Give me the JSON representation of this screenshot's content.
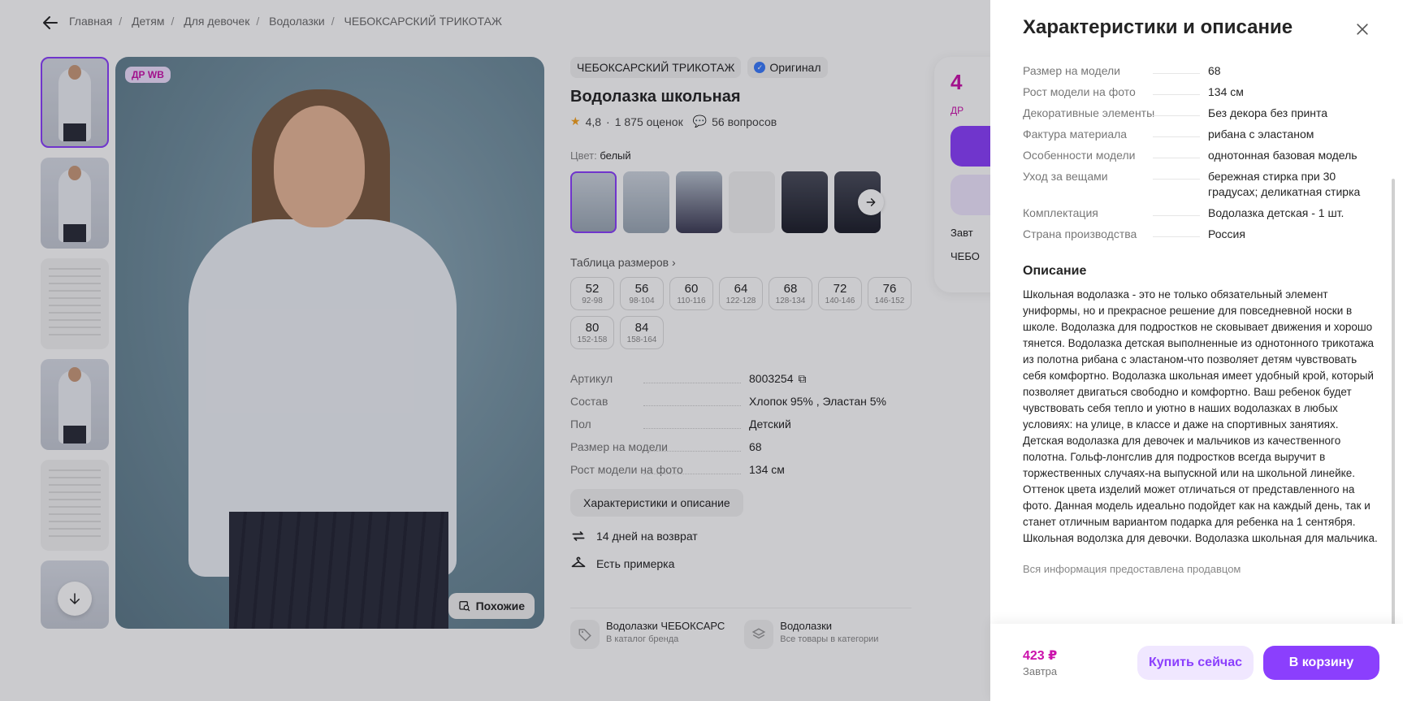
{
  "breadcrumb": [
    "Главная",
    "Детям",
    "Для девочек",
    "Водолазки",
    "ЧЕБОКСАРСКИЙ ТРИКОТАЖ"
  ],
  "gallery": {
    "badge": "ДР WB",
    "similar_label": "Похожие"
  },
  "product": {
    "brand": "ЧЕБОКСАРСКИЙ ТРИКОТАЖ",
    "original": "Оригинал",
    "title": "Водолазка школьная",
    "rating": "4,8",
    "reviews": "1 875 оценок",
    "questions": "56 вопросов",
    "color_label": "Цвет:",
    "color_value": "белый",
    "sizes_link": "Таблица размеров",
    "sizes": [
      {
        "n": "52",
        "r": "92-98"
      },
      {
        "n": "56",
        "r": "98-104"
      },
      {
        "n": "60",
        "r": "110-116"
      },
      {
        "n": "64",
        "r": "122-128"
      },
      {
        "n": "68",
        "r": "128-134"
      },
      {
        "n": "72",
        "r": "140-146"
      },
      {
        "n": "76",
        "r": "146-152"
      },
      {
        "n": "80",
        "r": "152-158"
      },
      {
        "n": "84",
        "r": "158-164"
      }
    ],
    "specs": [
      {
        "k": "Артикул",
        "v": "8003254"
      },
      {
        "k": "Состав",
        "v": "Хлопок 95% , Эластан 5%"
      },
      {
        "k": "Пол",
        "v": "Детский"
      },
      {
        "k": "Размер на модели",
        "v": "68"
      },
      {
        "k": "Рост модели на фото",
        "v": "134 см"
      }
    ],
    "specs_button": "Характеристики и описание",
    "perks": [
      "14 дней на возврат",
      "Есть примерка"
    ],
    "brand_link": {
      "title": "Водолазки ЧЕБОКСАРС",
      "sub": "В каталог бренда"
    },
    "category_link": {
      "title": "Водолазки",
      "sub": "Все товары в категории"
    }
  },
  "buybox": {
    "price_partial": "4",
    "dr_partial": "ДР",
    "delivery": "Завт",
    "seller": "ЧЕБО"
  },
  "drawer": {
    "title": "Характеристики и описание",
    "attributes": [
      {
        "k": "Размер на модели",
        "v": "68"
      },
      {
        "k": "Рост модели на фото",
        "v": "134 см"
      },
      {
        "k": "Декоративные элементы",
        "v": "Без декора без принта"
      },
      {
        "k": "Фактура материала",
        "v": "рибана с эластаном"
      },
      {
        "k": "Особенности модели",
        "v": "однотонная базовая модель"
      },
      {
        "k": "Уход за вещами",
        "v": "бережная стирка при 30 градусах; деликатная стирка"
      },
      {
        "k": "Комплектация",
        "v": "Водолазка детская - 1 шт."
      },
      {
        "k": "Страна производства",
        "v": "Россия"
      }
    ],
    "description_title": "Описание",
    "description": "Школьная водолазка - это не только обязательный элемент униформы, но и прекрасное решение для повседневной носки в школе. Водолазка для подростков не сковывает движения и хорошо тянется. Водолазка детская выполненные из однотонного трикотажа из полотна рибана с эластаном-что позволяет детям чувствовать себя комфортно. Водолазка школьная имеет удобный крой, который позволяет двигаться свободно и комфортно. Ваш ребенок будет чувствовать себя тепло и уютно в наших водолазках в любых условиях: на улице, в классе и даже на спортивных занятиях. Детская водолазка для девочек и мальчиков из качественного полотна. Гольф-лонгслив для подростков всегда выручит в торжественных случаях-на выпускной или на школьной линейке. Оттенок цвета изделий может отличаться от представленного на фото. Данная модель идеально подойдет как на каждый день, так и станет отличным вариантом подарка для ребенка на 1 сентября. Школьная водолзка для девочки. Водолазка школьная для мальчика.",
    "seller_note": "Вся информация предоставлена продавцом",
    "footer": {
      "price": "423 ₽",
      "date": "Завтра",
      "buy_now": "Купить сейчас",
      "add_to_cart": "В корзину"
    }
  },
  "colors": {
    "accent": "#8b3ffd",
    "price": "#cb11ab"
  }
}
